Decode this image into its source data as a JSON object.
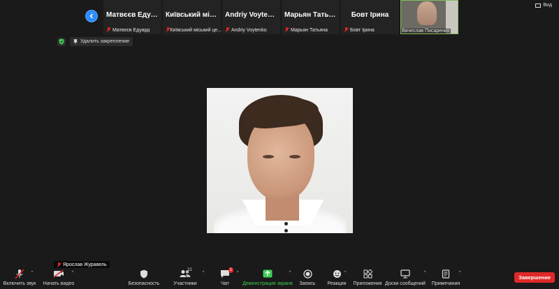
{
  "top_strip": {
    "participants": [
      {
        "name": "Матвєєв Едуард",
        "label": "Матвєєв Едуард"
      },
      {
        "name": "Київський місь...",
        "label": "Київський міський це..."
      },
      {
        "name": "Andriy Voytenko",
        "label": "Andriy Voytenko"
      },
      {
        "name": "Марьян Татьяна",
        "label": "Марьян Татьяна"
      },
      {
        "name": "Бовт Ірина",
        "label": "Бовт Ірина"
      }
    ],
    "video_participant": {
      "label": "Вячеслав Писаренко"
    },
    "view_label": "Вид"
  },
  "unpin_label": "Удалить закрепление",
  "speaker_name": "Ярослав Журавель",
  "toolbar": {
    "unmute": "Включить звук",
    "start_video": "Начать видео",
    "security": "Безопасность",
    "participants": "Участники",
    "participants_count": "22",
    "chat": "Чат",
    "chat_badge": "1",
    "share_screen": "Демонстрация экрана",
    "record": "Запись",
    "reactions": "Реакции",
    "apps": "Приложения",
    "whiteboards": "Доски сообщений",
    "notes": "Примечания",
    "end": "Завершение"
  },
  "colors": {
    "accent_blue": "#2d8cff",
    "share_green": "#3fce55",
    "end_red": "#e02828"
  }
}
